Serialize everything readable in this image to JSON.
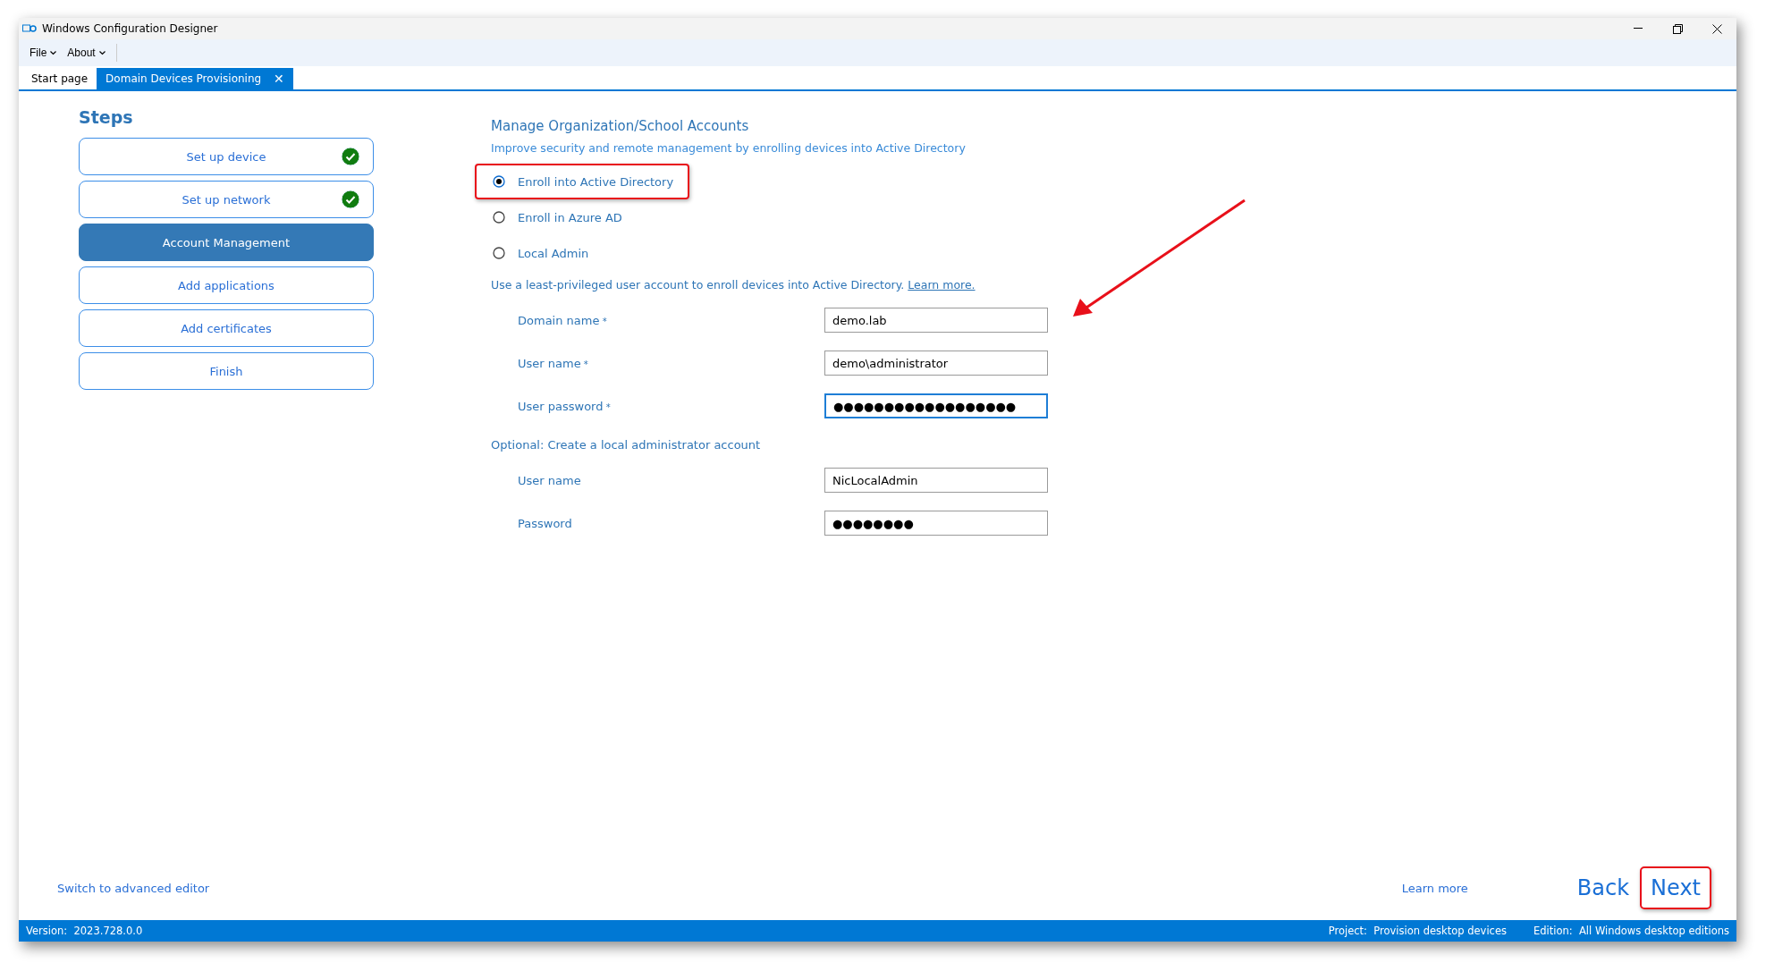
{
  "window": {
    "title": "Windows Configuration Designer"
  },
  "menu": [
    {
      "label": "File"
    },
    {
      "label": "About"
    }
  ],
  "tabs": [
    {
      "label": "Start page",
      "selected": false
    },
    {
      "label": "Domain Devices Provisioning",
      "selected": true,
      "close_glyph": "✕"
    }
  ],
  "steps": {
    "title": "Steps",
    "items": [
      {
        "label": "Set up device",
        "selected": false,
        "done": true
      },
      {
        "label": "Set up network",
        "selected": false,
        "done": true
      },
      {
        "label": "Account Management",
        "selected": true,
        "done": false
      },
      {
        "label": "Add applications",
        "selected": false,
        "done": false
      },
      {
        "label": "Add certificates",
        "selected": false,
        "done": false
      },
      {
        "label": "Finish",
        "selected": false,
        "done": false
      }
    ]
  },
  "form": {
    "title": "Manage Organization/School Accounts",
    "subtitle": "Improve security and remote management by enrolling devices into Active Directory",
    "options": [
      {
        "label": "Enroll into Active Directory",
        "selected": true,
        "highlighted": true
      },
      {
        "label": "Enroll in Azure AD",
        "selected": false,
        "highlighted": false
      },
      {
        "label": "Local Admin",
        "selected": false,
        "highlighted": false
      }
    ],
    "note": "Use a least-privileged user account to enroll devices into Active Directory.",
    "note_link": "Learn more.",
    "fields": [
      {
        "label": "Domain name",
        "required_mark": "*",
        "value": "demo.lab",
        "focused": false
      },
      {
        "label": "User name",
        "required_mark": "*",
        "value": "demo\\administrator",
        "focused": false
      },
      {
        "label": "User password",
        "required_mark": "*",
        "value": "●●●●●●●●●●●●●●●●●●",
        "focused": true
      }
    ],
    "optional_title": "Optional: Create a local administrator account",
    "optional_fields": [
      {
        "label": "User name",
        "value": "NicLocalAdmin",
        "focused": false
      },
      {
        "label": "Password",
        "value": "●●●●●●●●",
        "focused": false
      }
    ]
  },
  "footer": {
    "advanced_link": "Switch to advanced editor",
    "learn_more": "Learn more",
    "buttons": [
      {
        "label": "Back",
        "highlighted": false
      },
      {
        "label": "Next",
        "highlighted": true
      }
    ]
  },
  "status_bar": {
    "version": "Version:  2023.728.0.0",
    "project": "Project:  Provision desktop devices",
    "edition": "Edition:  All Windows desktop editions"
  }
}
